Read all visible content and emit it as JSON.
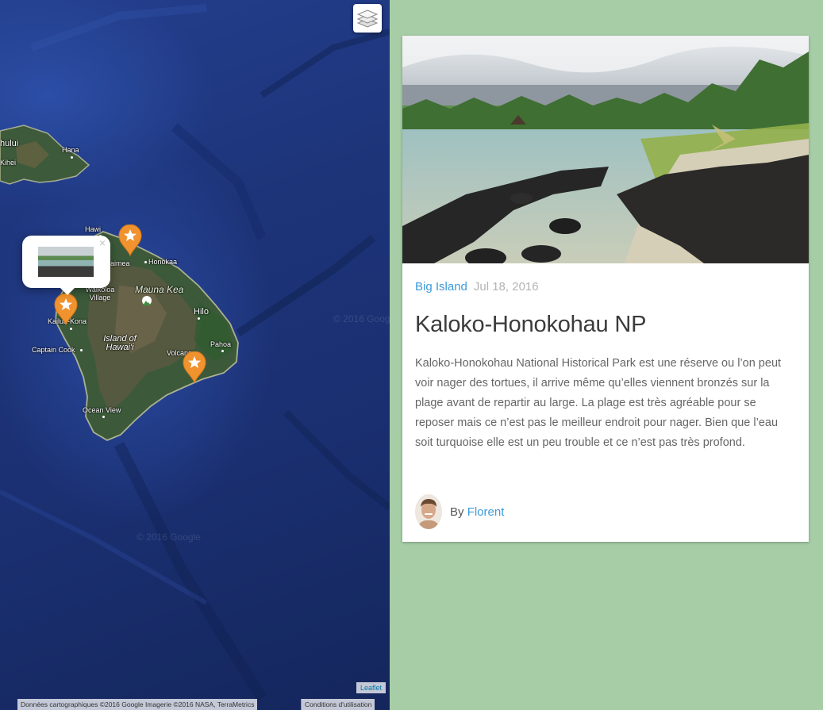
{
  "map": {
    "layers_icon": "layers-icon",
    "popup_close": "×",
    "labels": {
      "kahului": "hului",
      "kihei": "Kihei",
      "hana": "Hana",
      "hawi": "Hawi",
      "waimea": "aimea",
      "honokaa": "Honokaa",
      "mauna_kea": "Mauna Kea",
      "waikoloa": "Waikoloa Village",
      "hilo": "Hilo",
      "kailua_kona": "Kailua-Kona",
      "captain_cook": "Captain Cook",
      "island_of_hawaii": "Island of Hawai'i",
      "volcano": "Volcano",
      "pahoa": "Pahoa",
      "ocean_view": "Ocean View"
    },
    "watermark": "© 2016 Google",
    "attribution": "Données cartographiques ©2016 Google Imagerie ©2016 NASA, TerraMetrics",
    "terms": "Conditions d'utilisation",
    "leaflet": "Leaflet",
    "marker_color": "#f0922e"
  },
  "post": {
    "category": "Big Island",
    "date": "Jul 18, 2016",
    "title": "Kaloko-Honokohau NP",
    "body": "Kaloko-Honokohau National Historical Park est une réserve ou l’on peut voir nager des tortues, il arrive même qu’elles viennent bronzés sur la plage avant de repartir au large. La plage est très agréable pour se reposer mais ce n’est pas le meilleur endroit pour nager. Bien que l’eau soit turquoise elle est un peu trouble et ce n’est pas très profond.",
    "by": "By",
    "author": "Florent",
    "accent_color": "#3d9ad8"
  }
}
